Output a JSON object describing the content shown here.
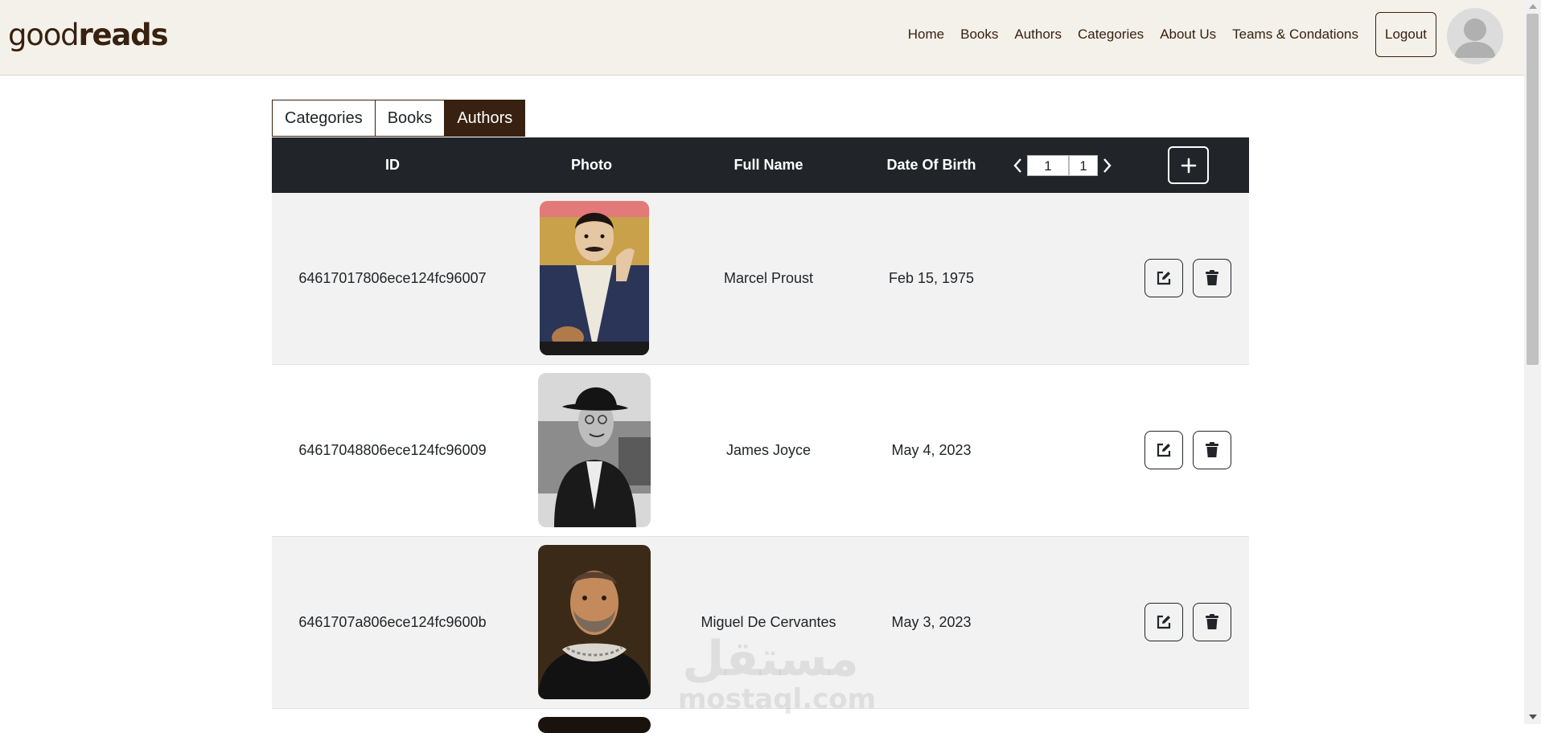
{
  "brand": {
    "logo_part1": "good",
    "logo_part2": "reads"
  },
  "nav": {
    "links": [
      "Home",
      "Books",
      "Authors",
      "Categories",
      "About Us",
      "Teams & Condations"
    ],
    "logout_label": "Logout"
  },
  "tabs": [
    {
      "label": "Categories",
      "active": false
    },
    {
      "label": "Books",
      "active": false
    },
    {
      "label": "Authors",
      "active": true
    }
  ],
  "table": {
    "headers": {
      "id": "ID",
      "photo": "Photo",
      "full_name": "Full Name",
      "dob": "Date Of Birth"
    },
    "pagination": {
      "current_page": "1",
      "total_pages": "1"
    },
    "rows": [
      {
        "id": "64617017806ece124fc96007",
        "full_name": "Marcel Proust",
        "dob": "Feb 15, 1975",
        "photo": "portrait-painting"
      },
      {
        "id": "64617048806ece124fc96009",
        "full_name": "James Joyce",
        "dob": "May 4, 2023",
        "photo": "portrait-photo-bw"
      },
      {
        "id": "6461707a806ece124fc9600b",
        "full_name": "Miguel De Cervantes",
        "dob": "May 3, 2023",
        "photo": "portrait-painting"
      }
    ]
  },
  "watermark": {
    "arabic": "مستقل",
    "latin": "mostaql.com"
  },
  "colors": {
    "brand_brown": "#382110",
    "navbar_bg": "#f4f1ea",
    "table_header_bg": "#212529",
    "row_stripe": "#f2f2f2"
  }
}
